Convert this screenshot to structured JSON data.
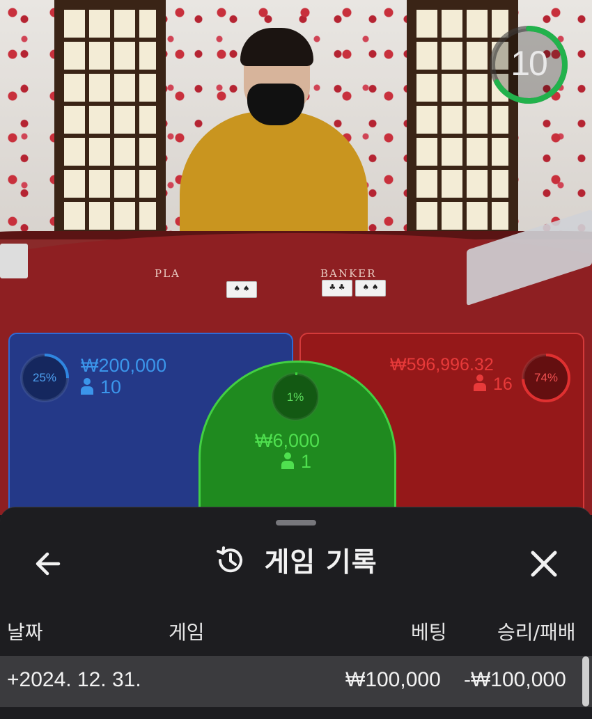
{
  "timer": {
    "seconds": "10",
    "remaining_fraction": 0.67,
    "color": "#22b24c"
  },
  "table": {
    "player_label": "PLA",
    "banker_label": "BANKER"
  },
  "bets": {
    "player": {
      "percent": "25%",
      "percent_value": 0.25,
      "amount": "₩200,000",
      "count": "10",
      "color": "#2f86e0"
    },
    "tie": {
      "percent": "1%",
      "percent_value": 0.01,
      "amount": "₩6,000",
      "count": "1",
      "color": "#3ad43a"
    },
    "banker": {
      "percent": "74%",
      "percent_value": 0.74,
      "amount": "₩596,996.32",
      "count": "16",
      "color": "#e03030"
    }
  },
  "sheet": {
    "title": "게임 기록",
    "icons": {
      "back": "arrow-left-icon",
      "history": "history-icon",
      "close": "close-icon"
    },
    "columns": {
      "date": "날짜",
      "game": "게임",
      "bet": "베팅",
      "result": "승리/패배"
    },
    "rows": [
      {
        "date": "+2024. 12. 31.",
        "game": "",
        "bet": "₩100,000",
        "result": "-₩100,000"
      }
    ]
  }
}
